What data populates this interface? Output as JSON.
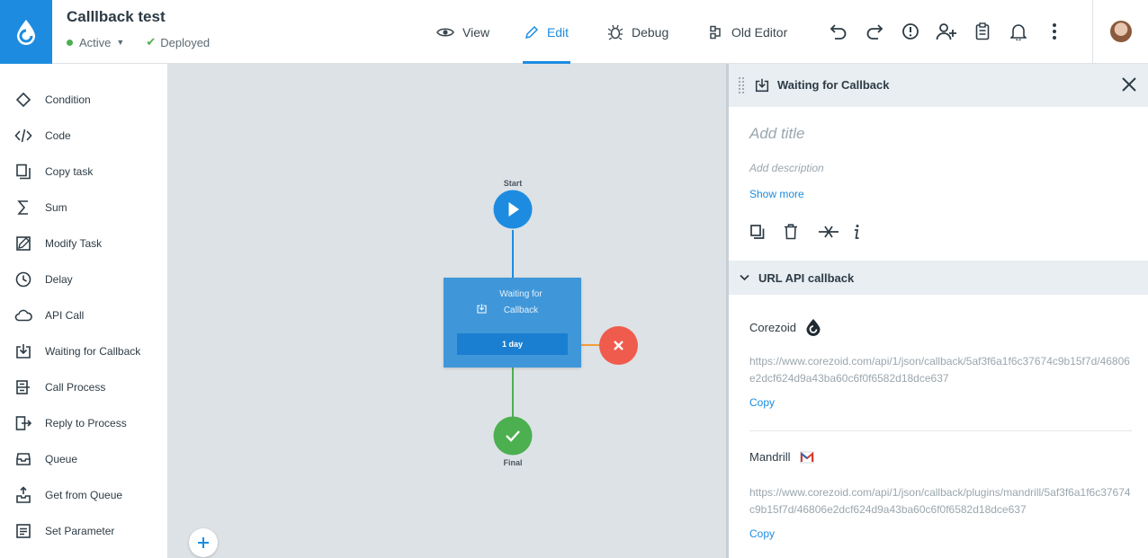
{
  "header": {
    "title": "Calllback test",
    "status": "Active",
    "deploy_status": "Deployed",
    "nav": [
      {
        "label": "View",
        "icon": "eye-icon"
      },
      {
        "label": "Edit",
        "icon": "pencil-icon",
        "active": true
      },
      {
        "label": "Debug",
        "icon": "bug-icon"
      },
      {
        "label": "Old Editor",
        "icon": "old-editor-icon"
      }
    ],
    "actions": [
      "undo-icon",
      "redo-icon",
      "alert-icon",
      "add-user-icon",
      "clipboard-icon",
      "bell-icon",
      "more-vertical-icon"
    ]
  },
  "sidebar": {
    "items": [
      {
        "label": "Condition",
        "icon": "condition-icon"
      },
      {
        "label": "Code",
        "icon": "code-icon"
      },
      {
        "label": "Copy task",
        "icon": "copy-task-icon"
      },
      {
        "label": "Sum",
        "icon": "sigma-icon"
      },
      {
        "label": "Modify Task",
        "icon": "modify-task-icon"
      },
      {
        "label": "Delay",
        "icon": "clock-icon"
      },
      {
        "label": "API Call",
        "icon": "cloud-icon"
      },
      {
        "label": "Waiting for Callback",
        "icon": "callback-icon"
      },
      {
        "label": "Call Process",
        "icon": "call-process-icon"
      },
      {
        "label": "Reply to Process",
        "icon": "reply-process-icon"
      },
      {
        "label": "Queue",
        "icon": "queue-icon"
      },
      {
        "label": "Get from Queue",
        "icon": "get-queue-icon"
      },
      {
        "label": "Set Parameter",
        "icon": "set-parameter-icon"
      }
    ]
  },
  "canvas": {
    "start_label": "Start",
    "final_label": "Final",
    "node_title": "Waiting for Callback",
    "node_timeout": "1 day"
  },
  "panel": {
    "title": "Waiting for Callback",
    "add_title_placeholder": "Add title",
    "add_description_placeholder": "Add description",
    "show_more": "Show more",
    "section_title": "URL API callback",
    "callbacks": [
      {
        "name": "Corezoid",
        "url": "https://www.corezoid.com/api/1/json/callback/5af3f6a1f6c37674c9b15f7d/46806e2dcf624d9a43ba60c6f0f6582d18dce637",
        "copy": "Copy"
      },
      {
        "name": "Mandrill",
        "url": "https://www.corezoid.com/api/1/json/callback/plugins/mandrill/5af3f6a1f6c37674c9b15f7d/46806e2dcf624d9a43ba60c6f0f6582d18dce637",
        "copy": "Copy"
      }
    ]
  },
  "colors": {
    "accent": "#1d8ce0",
    "success": "#4caf50",
    "error": "#ef5b4c",
    "canvas": "#dde2e6"
  }
}
